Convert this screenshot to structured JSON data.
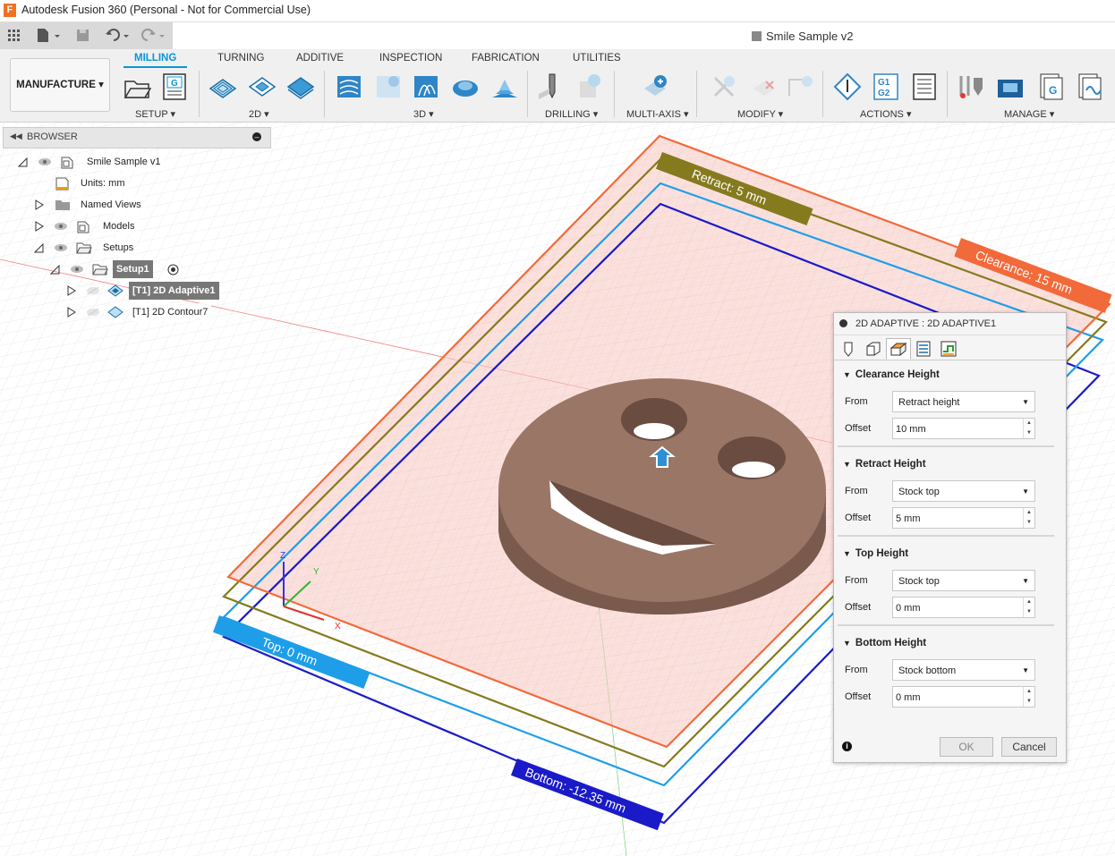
{
  "app": {
    "title": "Autodesk Fusion 360 (Personal - Not for Commercial Use)",
    "document_title": "Smile Sample v2"
  },
  "workspace": {
    "label": "MANUFACTURE"
  },
  "tabs": [
    "MILLING",
    "TURNING",
    "ADDITIVE",
    "INSPECTION",
    "FABRICATION",
    "UTILITIES"
  ],
  "groups": [
    "SETUP",
    "2D",
    "3D",
    "DRILLING",
    "MULTI-AXIS",
    "MODIFY",
    "ACTIONS",
    "MANAGE"
  ],
  "icons": {
    "actions_g1g2": "G1\nG2",
    "setup_g": "G"
  },
  "browser": {
    "label": "BROWSER",
    "items": [
      {
        "label": "Smile Sample v1"
      },
      {
        "label": "Units: mm"
      },
      {
        "label": "Named Views"
      },
      {
        "label": "Models"
      },
      {
        "label": "Setups"
      },
      {
        "label": "Setup1"
      },
      {
        "label": "[T1] 2D Adaptive1"
      },
      {
        "label": "[T1] 2D Contour7"
      }
    ]
  },
  "viewport": {
    "plane_labels": {
      "clearance": "Clearance: 15 mm",
      "retract": "Retract: 5 mm",
      "top": "Top: 0 mm",
      "bottom": "Bottom: -12.35 mm"
    },
    "axes": {
      "x": "X",
      "y": "Y",
      "z": "Z"
    },
    "colors": {
      "clearance": "#f26a3a",
      "retract": "#857a1e",
      "top": "#1e9ee8",
      "bottom": "#1a1ac8",
      "part": "#8f6e60"
    }
  },
  "panel": {
    "title": "2D ADAPTIVE : 2D ADAPTIVE1",
    "sections": [
      {
        "title": "Clearance Height",
        "from": "Retract height",
        "offset": "10 mm"
      },
      {
        "title": "Retract Height",
        "from": "Stock top",
        "offset": "5 mm"
      },
      {
        "title": "Top Height",
        "from": "Stock top",
        "offset": "0 mm"
      },
      {
        "title": "Bottom Height",
        "from": "Stock bottom",
        "offset": "0 mm"
      }
    ],
    "from_label": "From",
    "offset_label": "Offset",
    "ok": "OK",
    "cancel": "Cancel"
  }
}
